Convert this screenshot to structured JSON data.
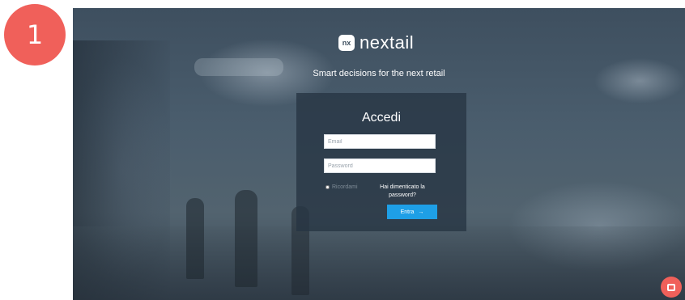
{
  "step_badge": "1",
  "brand": {
    "mark": "nx",
    "name": "nextail",
    "tagline": "Smart decisions for the next retail"
  },
  "login": {
    "title": "Accedi",
    "email_placeholder": "Email",
    "password_placeholder": "Password",
    "remember_label": "Ricordami",
    "forgot_label": "Hai dimenticato la password?",
    "submit_label": "Entra",
    "submit_icon": "arrow-right-icon"
  },
  "chat": {
    "icon": "chat-icon"
  },
  "colors": {
    "badge": "#f0605a",
    "primary_button": "#1e9fe6",
    "panel": "#263442"
  }
}
